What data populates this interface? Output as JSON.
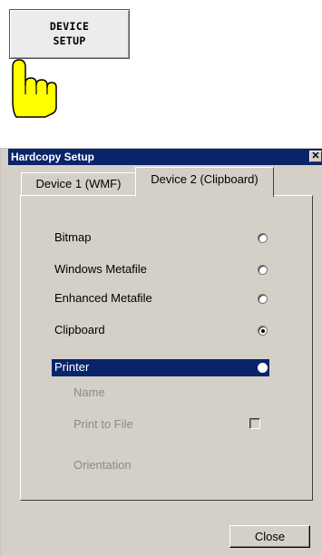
{
  "softkey": {
    "line1": "DEVICE",
    "line2": "SETUP"
  },
  "dialog": {
    "title": "Hardcopy Setup",
    "close_glyph": "✕",
    "tabs": [
      {
        "label": "Device 1 (WMF)",
        "active": false
      },
      {
        "label": "Device 2 (Clipboard)",
        "active": true
      }
    ],
    "options": [
      {
        "label": "Bitmap",
        "checked": false
      },
      {
        "label": "Windows Metafile",
        "checked": false
      },
      {
        "label": "Enhanced Metafile",
        "checked": false
      },
      {
        "label": "Clipboard",
        "checked": true
      },
      {
        "label": "Printer",
        "checked": false,
        "highlighted": true
      }
    ],
    "printer_settings": {
      "name_label": "Name",
      "print_to_file_label": "Print to File",
      "print_to_file_checked": false,
      "orientation_label": "Orientation"
    },
    "close_button": "Close"
  },
  "colors": {
    "selection": "#0a246a",
    "dialog_bg": "#d4d0c8",
    "hand": "#ffff00"
  }
}
